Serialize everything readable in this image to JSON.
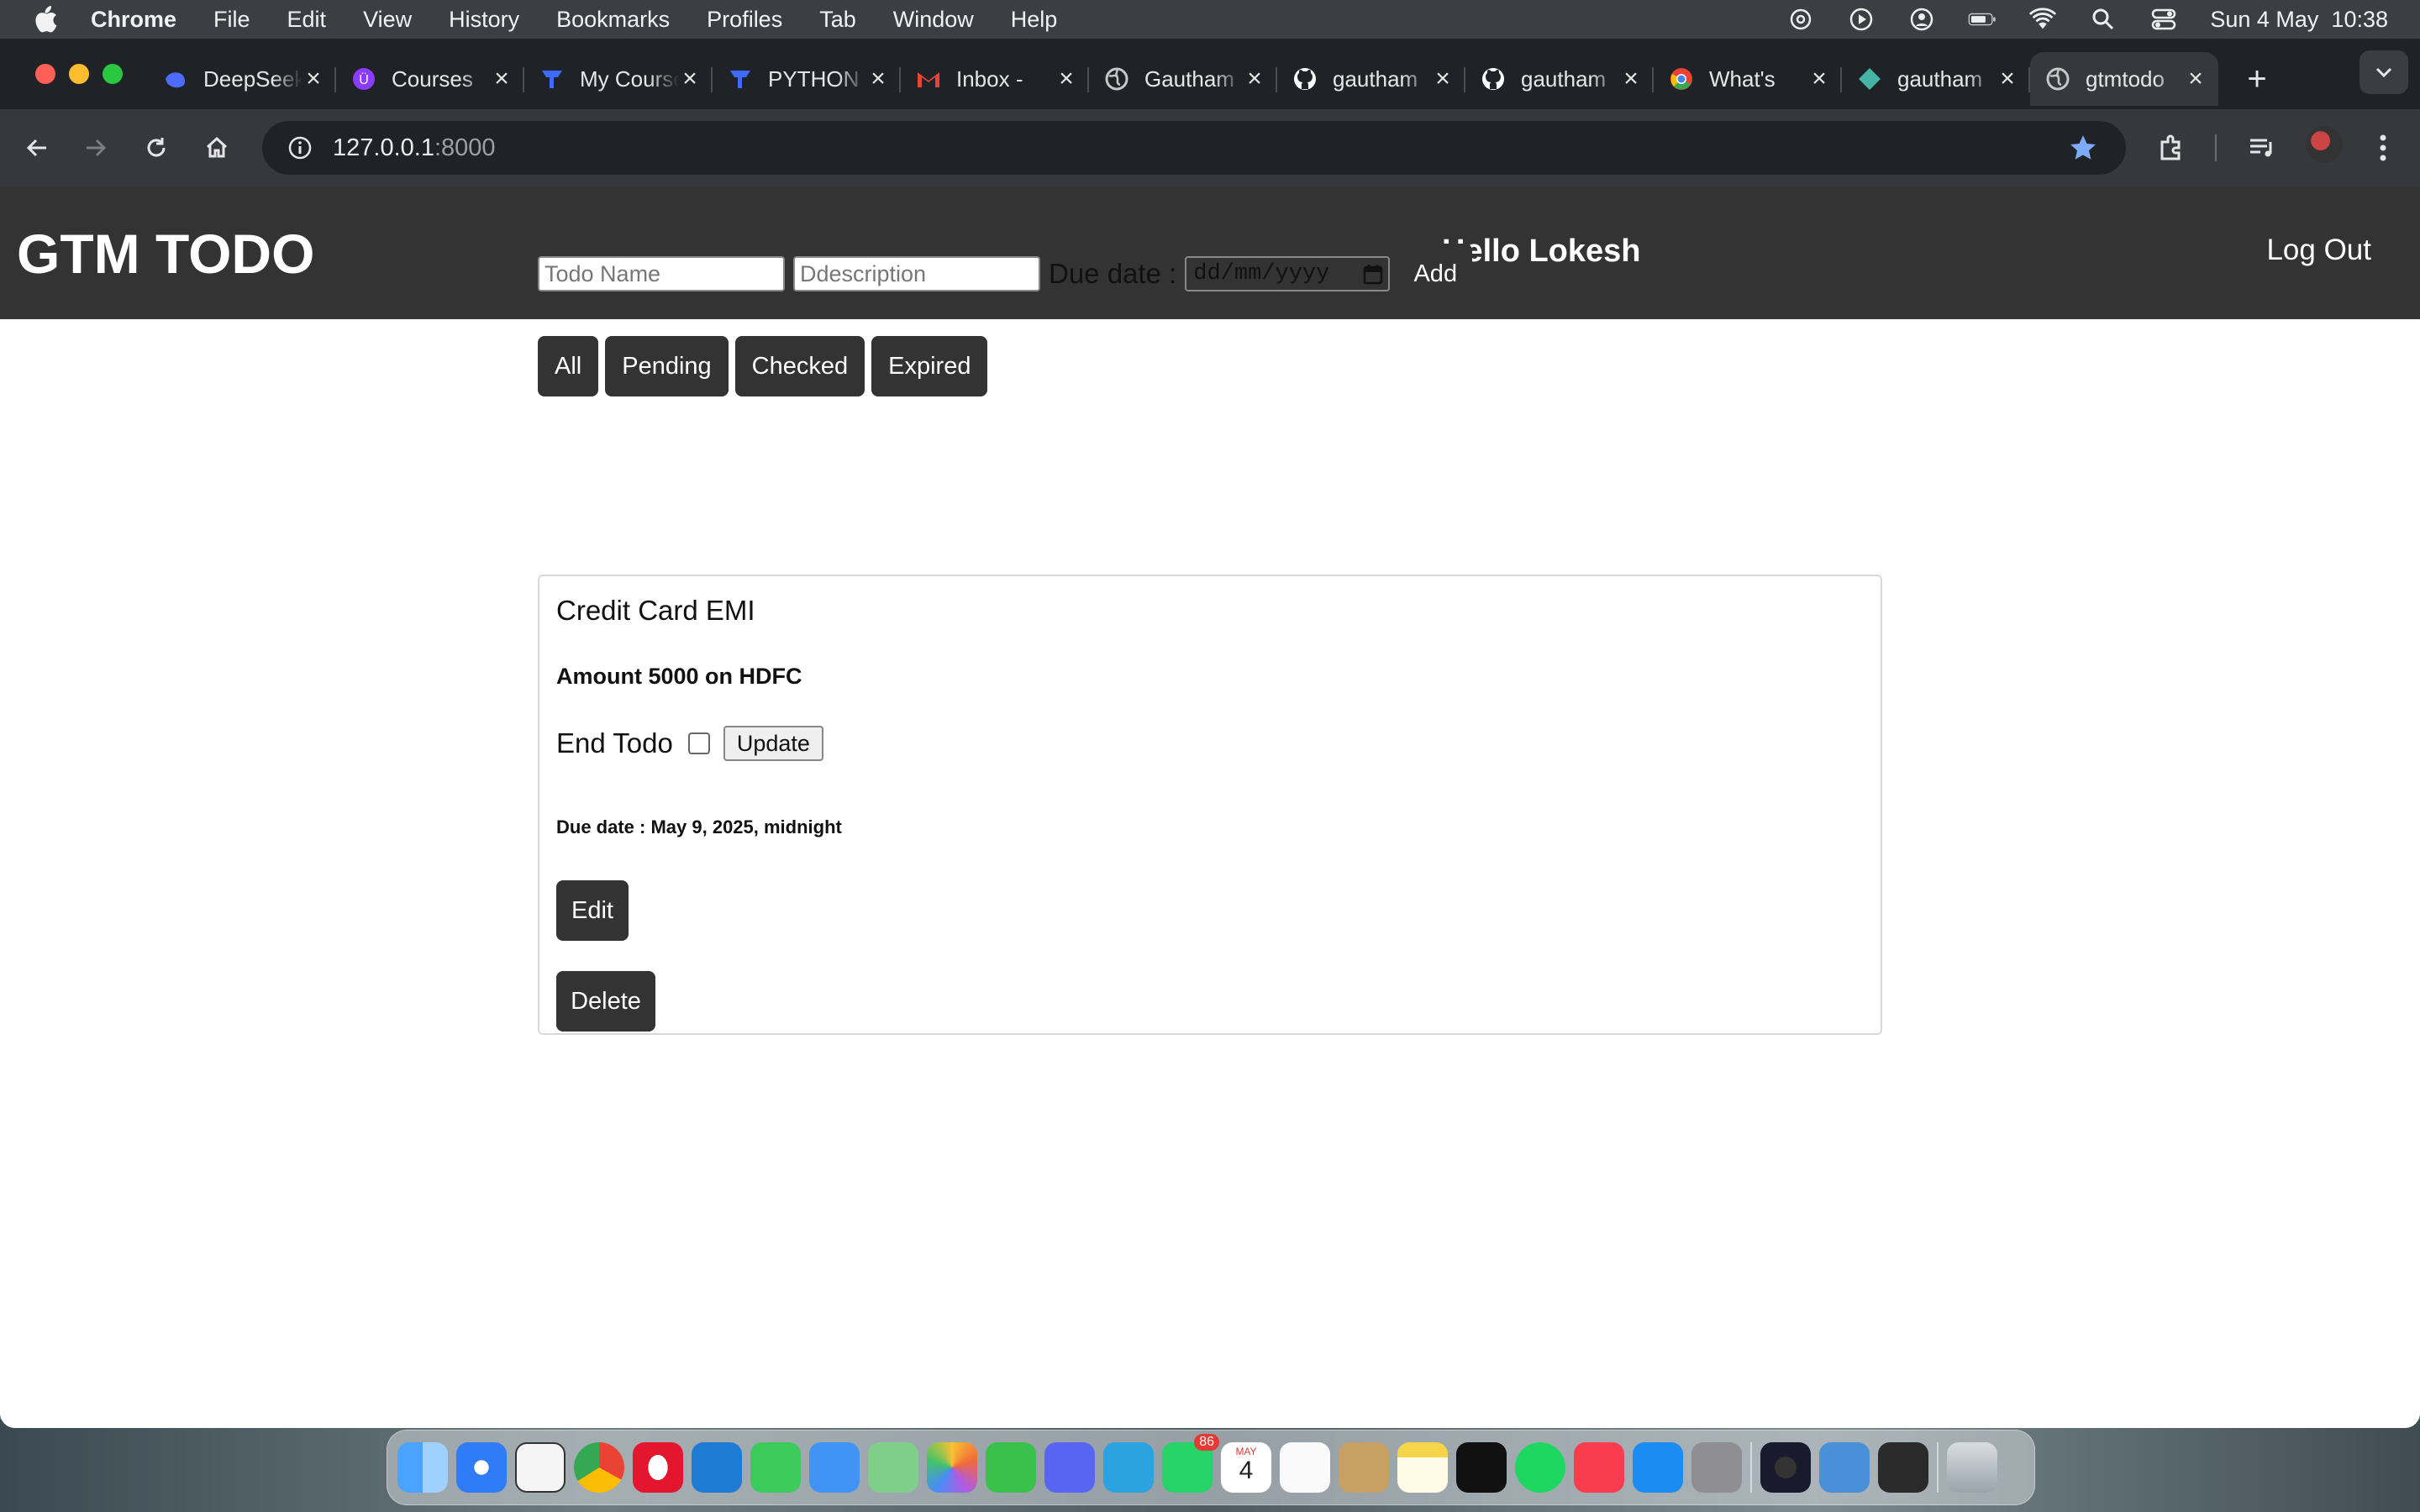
{
  "menubar": {
    "app": "Chrome",
    "items": [
      "File",
      "Edit",
      "View",
      "History",
      "Bookmarks",
      "Profiles",
      "Tab",
      "Window",
      "Help"
    ],
    "datetime": "Sun 4 May  10:38"
  },
  "tabs": [
    {
      "title": "DeepSeek",
      "icon": "deepseek-icon",
      "color": "#4d6bfe"
    },
    {
      "title": "Courses",
      "icon": "course-icon",
      "color": "#8b3dff"
    },
    {
      "title": "My Courses",
      "icon": "teachable-icon",
      "color": "#3d6bff"
    },
    {
      "title": "PYTHON",
      "icon": "teachable-icon",
      "color": "#3d6bff"
    },
    {
      "title": "Inbox -",
      "icon": "gmail-icon",
      "color": "#ea4335"
    },
    {
      "title": "Gautham",
      "icon": "globe-icon",
      "color": "#c7c7c7"
    },
    {
      "title": "gautham",
      "icon": "github-icon",
      "color": "#ffffff"
    },
    {
      "title": "gautham",
      "icon": "github-icon",
      "color": "#ffffff"
    },
    {
      "title": "What's",
      "icon": "chrome-icon",
      "color": "#4285f4"
    },
    {
      "title": "gautham",
      "icon": "render-icon",
      "color": "#46b4a4"
    },
    {
      "title": "gtmtodo",
      "icon": "globe-icon",
      "color": "#c7c7c7",
      "active": true
    }
  ],
  "address": {
    "host": "127.0.0.1",
    "port": ":8000"
  },
  "app": {
    "brand": "GTM TODO",
    "greeting": "Hello Lokesh",
    "logout": "Log Out"
  },
  "form": {
    "name_placeholder": "Todo Name",
    "desc_placeholder": "Ddescription",
    "due_label": "Due date :",
    "date_placeholder": "dd/mm/yyyy",
    "add_label": "Add"
  },
  "filters": [
    "All",
    "Pending",
    "Checked",
    "Expired"
  ],
  "todo": {
    "title": "Credit Card EMI",
    "description": "Amount 5000 on HDFC",
    "end_label": "End Todo",
    "update_label": "Update",
    "due": "Due date : May 9, 2025, midnight",
    "edit_label": "Edit",
    "delete_label": "Delete"
  },
  "dock": {
    "whatsapp_badge": "86",
    "calendar_month": "MAY",
    "calendar_day": "4"
  }
}
